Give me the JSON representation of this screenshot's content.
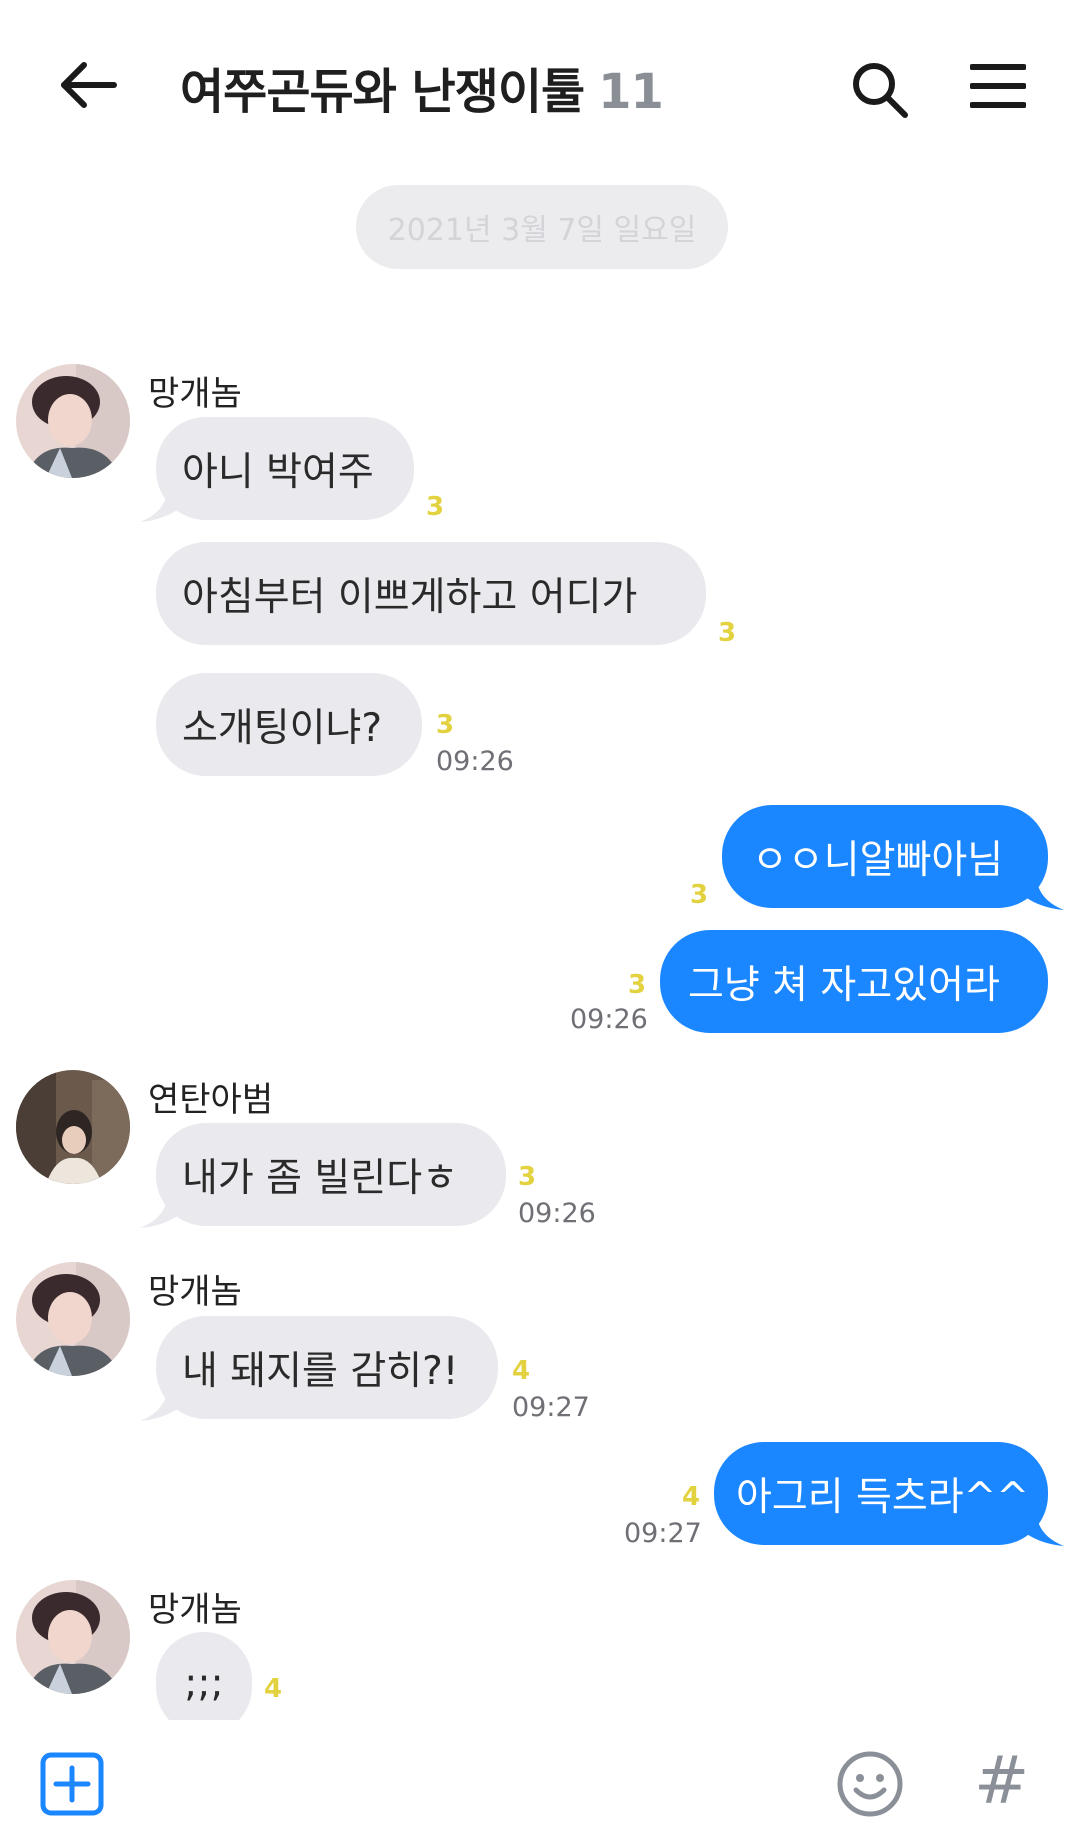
{
  "header": {
    "title": "여쭈곤듀와 난쟁이툴",
    "member_count": "11",
    "back_icon": "arrow-left-icon",
    "search_icon": "search-icon",
    "menu_icon": "hamburger-menu-icon"
  },
  "date_divider": "2021년 3월 7일 일요일",
  "messages": [
    {
      "sender": "망개놈",
      "text": "아니 박여주",
      "unread": "3",
      "time": ""
    },
    {
      "sender": "",
      "text": "아침부터 이쁘게하고 어디가",
      "unread": "3",
      "time": ""
    },
    {
      "sender": "",
      "text": "소개팅이냐?",
      "unread": "3",
      "time": "09:26"
    },
    {
      "sender": "me",
      "text": "ㅇㅇ니알빠아님",
      "unread": "3",
      "time": ""
    },
    {
      "sender": "me",
      "text": "그냥 쳐 자고있어라",
      "unread": "3",
      "time": "09:26"
    },
    {
      "sender": "연탄아범",
      "text": "내가 좀 빌린다ㅎ",
      "unread": "3",
      "time": "09:26"
    },
    {
      "sender": "망개놈",
      "text": "내 돼지를 감히?!",
      "unread": "4",
      "time": "09:27"
    },
    {
      "sender": "me",
      "text": "아그리 득츠라^^",
      "unread": "4",
      "time": "09:27"
    },
    {
      "sender": "망개놈",
      "text": ";;;",
      "unread": "4",
      "time": ""
    }
  ],
  "input_bar": {
    "plus_icon": "plus-square-icon",
    "emoji_icon": "smiley-icon",
    "hash_label": "#"
  },
  "colors": {
    "outgoing_bubble": "#1a86ff",
    "incoming_bubble": "#e9e9ee",
    "unread_count": "#e3d240"
  }
}
